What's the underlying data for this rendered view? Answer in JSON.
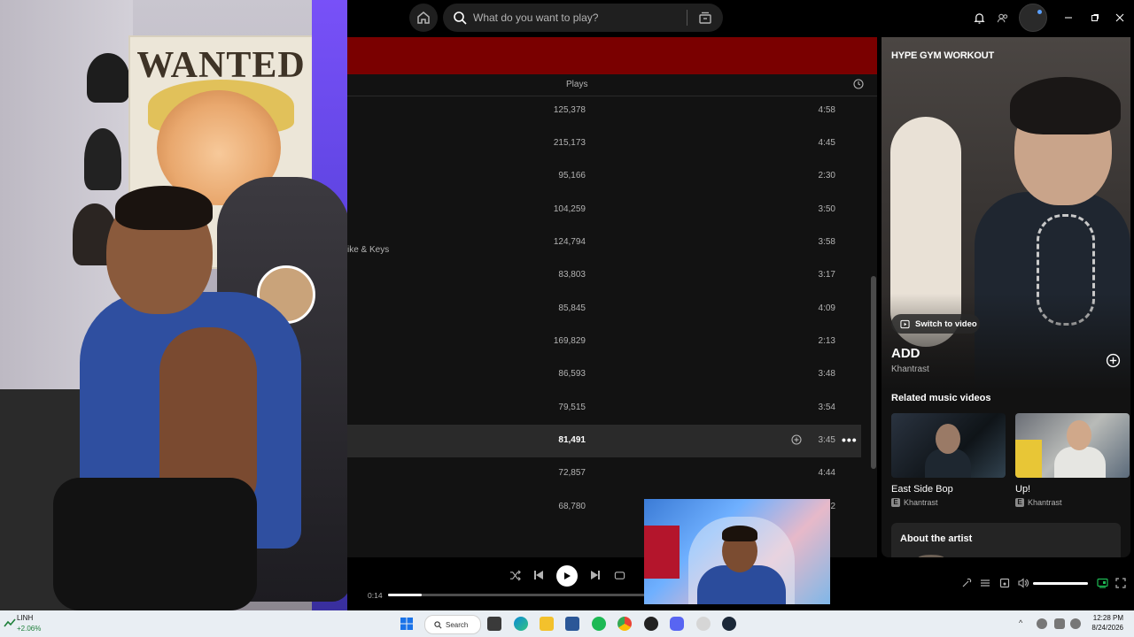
{
  "search": {
    "placeholder": "What do you want to play?"
  },
  "tracklist": {
    "header": {
      "plays": "Plays"
    },
    "rows": [
      {
        "plays": "125,378",
        "duration": "4:58"
      },
      {
        "plays": "215,173",
        "duration": "4:45"
      },
      {
        "plays": "95,166",
        "duration": "2:30"
      },
      {
        "plays": "104,259",
        "duration": "3:50"
      },
      {
        "plays": "124,794",
        "duration": "3:58",
        "artist_fragment": "ike & Keys"
      },
      {
        "plays": "83,803",
        "duration": "3:17"
      },
      {
        "plays": "85,845",
        "duration": "4:09"
      },
      {
        "plays": "169,829",
        "duration": "2:13"
      },
      {
        "plays": "86,593",
        "duration": "3:48"
      },
      {
        "plays": "79,515",
        "duration": "3:54"
      },
      {
        "plays": "81,491",
        "duration": "3:45",
        "selected": true
      },
      {
        "plays": "72,857",
        "duration": "4:44"
      },
      {
        "plays": "68,780",
        "duration_fragment": "2"
      }
    ]
  },
  "now_playing": {
    "playlist": "HYPE GYM WORKOUT",
    "switch_label": "Switch to video",
    "track": "ADD",
    "artist": "Khantrast",
    "related_heading": "Related music videos",
    "related": [
      {
        "title": "East Side Bop",
        "artist": "Khantrast",
        "badge": "E"
      },
      {
        "title": "Up!",
        "artist": "Khantrast",
        "badge": "E"
      }
    ],
    "about_heading": "About the artist"
  },
  "player": {
    "elapsed": "0:14",
    "progress_fraction": 0.13,
    "volume_fraction": 1.0
  },
  "webcam": {
    "poster_text": "WANTED"
  },
  "taskbar": {
    "stock_name": "LINH",
    "stock_change": "+2.06%",
    "search_label": "Search",
    "time": "12:28 PM",
    "date": "8/24/2026"
  },
  "colors": {
    "accent": "#1db954",
    "banner": "#7a0000",
    "panel": "#121212"
  },
  "icons": [
    "home-icon",
    "search-icon",
    "browse-icon",
    "bell-icon",
    "friends-icon",
    "minimize-icon",
    "maximize-icon",
    "close-icon",
    "clock-icon",
    "add-circle-icon",
    "more-icon",
    "play-icon",
    "shuffle-icon",
    "previous-icon",
    "next-icon",
    "repeat-icon",
    "volume-icon"
  ]
}
